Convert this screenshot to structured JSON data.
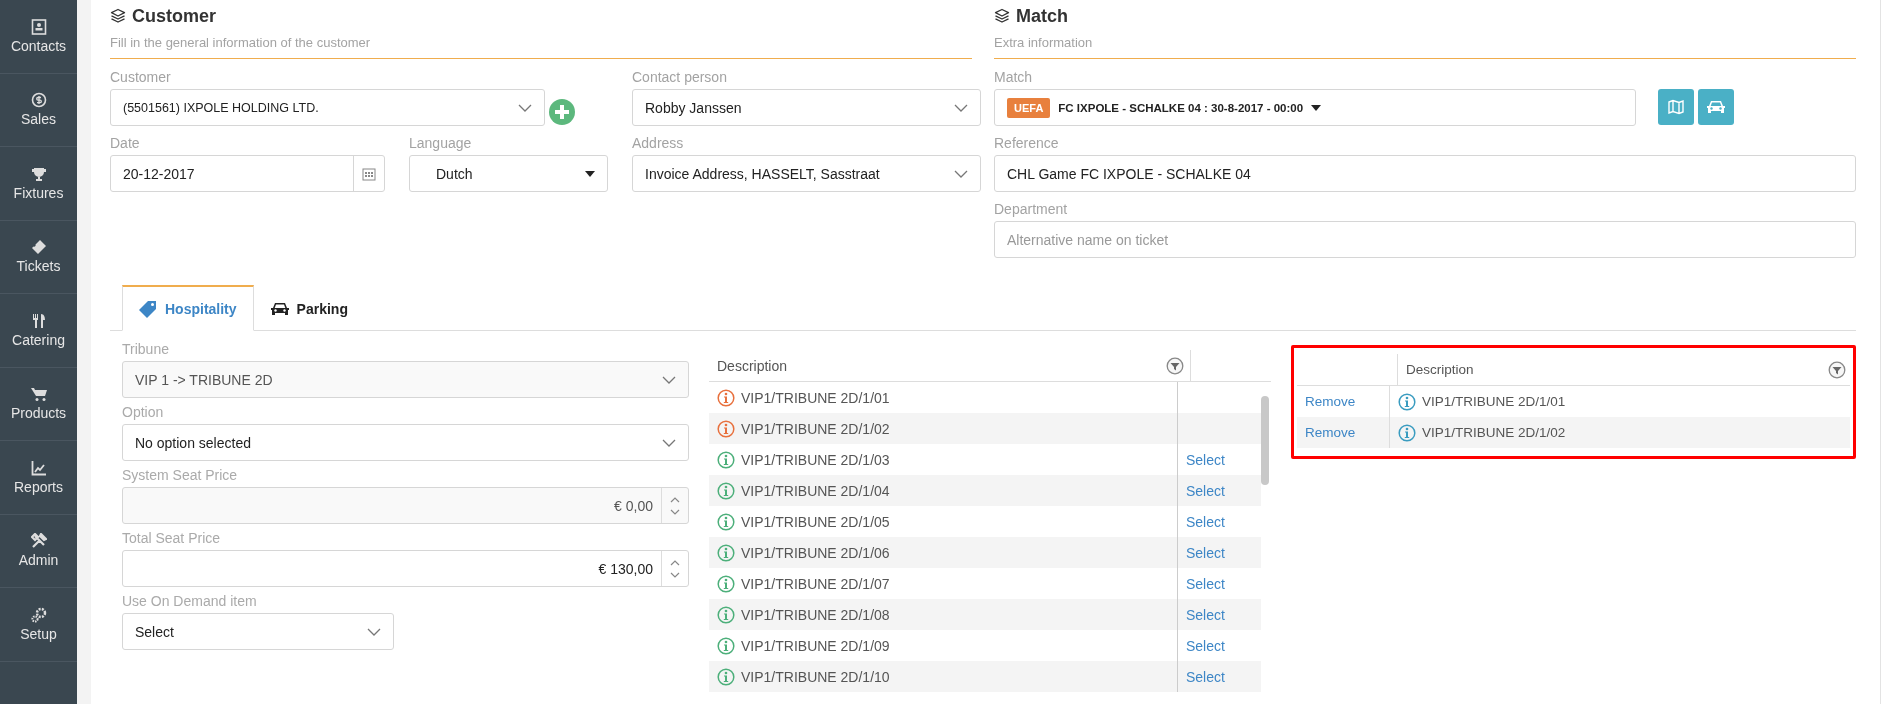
{
  "sidebar": {
    "items": [
      {
        "label": "Contacts",
        "selected": false
      },
      {
        "label": "Sales",
        "selected": false
      },
      {
        "label": "Fixtures",
        "selected": false
      },
      {
        "label": "Tickets",
        "selected": false
      },
      {
        "label": "Catering",
        "selected": false
      },
      {
        "label": "Products",
        "selected": false
      },
      {
        "label": "Reports",
        "selected": false
      },
      {
        "label": "Admin",
        "selected": false
      },
      {
        "label": "Setup",
        "selected": false
      }
    ]
  },
  "customer_section": {
    "title": "Customer",
    "subtitle": "Fill in the general information of the customer",
    "customer": {
      "label": "Customer",
      "value": "(5501561) IXPOLE HOLDING LTD."
    },
    "contact_person": {
      "label": "Contact person",
      "value": "Robby Janssen"
    },
    "date": {
      "label": "Date",
      "value": "20-12-2017"
    },
    "language": {
      "label": "Language",
      "value": "Dutch"
    },
    "address": {
      "label": "Address",
      "value": "Invoice Address, HASSELT, Sasstraat"
    }
  },
  "match_section": {
    "title": "Match",
    "subtitle": "Extra information",
    "match": {
      "label": "Match",
      "badge": "UEFA",
      "value": "FC IXPOLE - SCHALKE 04 : 30-8-2017 - 00:00"
    },
    "reference": {
      "label": "Reference",
      "value": "CHL Game FC IXPOLE - SCHALKE 04"
    },
    "department": {
      "label": "Department",
      "placeholder": "Alternative name on ticket"
    }
  },
  "tabs": [
    {
      "label": "Hospitality",
      "selected": true
    },
    {
      "label": "Parking",
      "selected": false
    }
  ],
  "hospitality": {
    "tribune": {
      "label": "Tribune",
      "value": "VIP 1 -> TRIBUNE 2D",
      "disabled": true
    },
    "option": {
      "label": "Option",
      "value": "No option selected",
      "disabled": false
    },
    "system_seat_price": {
      "label": "System Seat Price",
      "value": "€ 0,00",
      "disabled": true
    },
    "total_seat_price": {
      "label": "Total Seat Price",
      "value": "€ 130,00",
      "disabled": false
    },
    "on_demand": {
      "label": "Use On Demand item",
      "value": "Select",
      "disabled": false
    }
  },
  "seats_table": {
    "columns": [
      "Description"
    ],
    "rows": [
      {
        "description": "VIP1/TRIBUNE 2D/1/01",
        "available": false
      },
      {
        "description": "VIP1/TRIBUNE 2D/1/02",
        "available": false
      },
      {
        "description": "VIP1/TRIBUNE 2D/1/03",
        "available": true,
        "action": "Select"
      },
      {
        "description": "VIP1/TRIBUNE 2D/1/04",
        "available": true,
        "action": "Select"
      },
      {
        "description": "VIP1/TRIBUNE 2D/1/05",
        "available": true,
        "action": "Select"
      },
      {
        "description": "VIP1/TRIBUNE 2D/1/06",
        "available": true,
        "action": "Select"
      },
      {
        "description": "VIP1/TRIBUNE 2D/1/07",
        "available": true,
        "action": "Select"
      },
      {
        "description": "VIP1/TRIBUNE 2D/1/08",
        "available": true,
        "action": "Select"
      },
      {
        "description": "VIP1/TRIBUNE 2D/1/09",
        "available": true,
        "action": "Select"
      },
      {
        "description": "VIP1/TRIBUNE 2D/1/10",
        "available": true,
        "action": "Select"
      }
    ]
  },
  "selected_table": {
    "columns": [
      "Description"
    ],
    "rows": [
      {
        "action": "Remove",
        "description": "VIP1/TRIBUNE 2D/1/01"
      },
      {
        "action": "Remove",
        "description": "VIP1/TRIBUNE 2D/1/02"
      }
    ]
  }
}
